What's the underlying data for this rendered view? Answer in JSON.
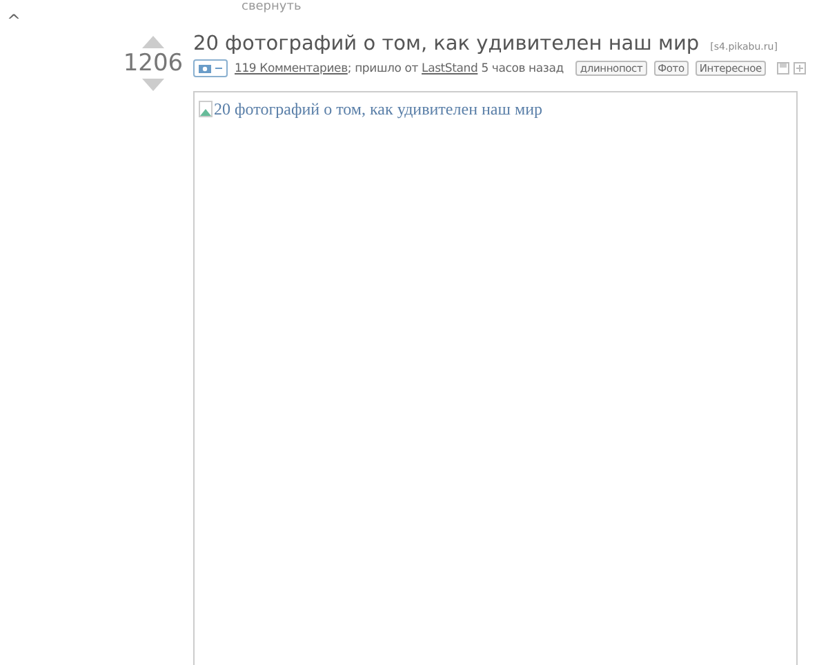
{
  "top_link": "свернуть",
  "collapse_icon": "^",
  "post": {
    "rating": "1206",
    "title": "20 фотографий о том, как удивителен наш мир",
    "source": "[s4.pikabu.ru]",
    "comments": "119 Комментариев",
    "via_text": "; пришло от",
    "author": "LastStand",
    "time": "5 часов назад",
    "photos_expanded": true,
    "tags": [
      "длиннопост",
      "Фото",
      "Интересное"
    ],
    "image_alt": "20 фотографий о том, как удивителен наш мир"
  }
}
